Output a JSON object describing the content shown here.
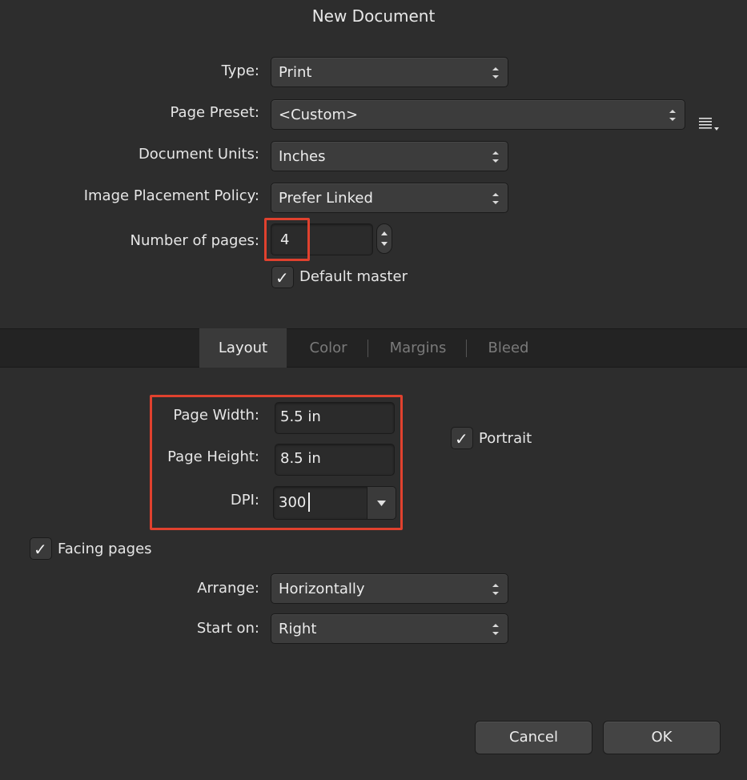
{
  "dialog": {
    "title": "New Document"
  },
  "form": {
    "type": {
      "label": "Type:",
      "value": "Print"
    },
    "page_preset": {
      "label": "Page Preset:",
      "value": "<Custom>"
    },
    "document_units": {
      "label": "Document Units:",
      "value": "Inches"
    },
    "image_placement": {
      "label": "Image Placement Policy:",
      "value": "Prefer Linked"
    },
    "number_of_pages": {
      "label": "Number of pages:",
      "value": "4"
    },
    "default_master": {
      "label": "Default master",
      "checked": true
    }
  },
  "tabs": [
    {
      "label": "Layout",
      "active": true
    },
    {
      "label": "Color",
      "active": false
    },
    {
      "label": "Margins",
      "active": false
    },
    {
      "label": "Bleed",
      "active": false
    }
  ],
  "layout": {
    "page_width": {
      "label": "Page Width:",
      "value": "5.5 in"
    },
    "page_height": {
      "label": "Page Height:",
      "value": "8.5 in"
    },
    "dpi": {
      "label": "DPI:",
      "value": "300"
    },
    "portrait": {
      "label": "Portrait",
      "checked": true
    },
    "facing_pages": {
      "label": "Facing pages",
      "checked": true
    },
    "arrange": {
      "label": "Arrange:",
      "value": "Horizontally"
    },
    "start_on": {
      "label": "Start on:",
      "value": "Right"
    }
  },
  "buttons": {
    "cancel": "Cancel",
    "ok": "OK"
  },
  "icons": {
    "check": "✓",
    "preset_menu": "list-menu-icon"
  },
  "colors": {
    "highlight": "#e0412e",
    "background": "#2d2d2d"
  }
}
